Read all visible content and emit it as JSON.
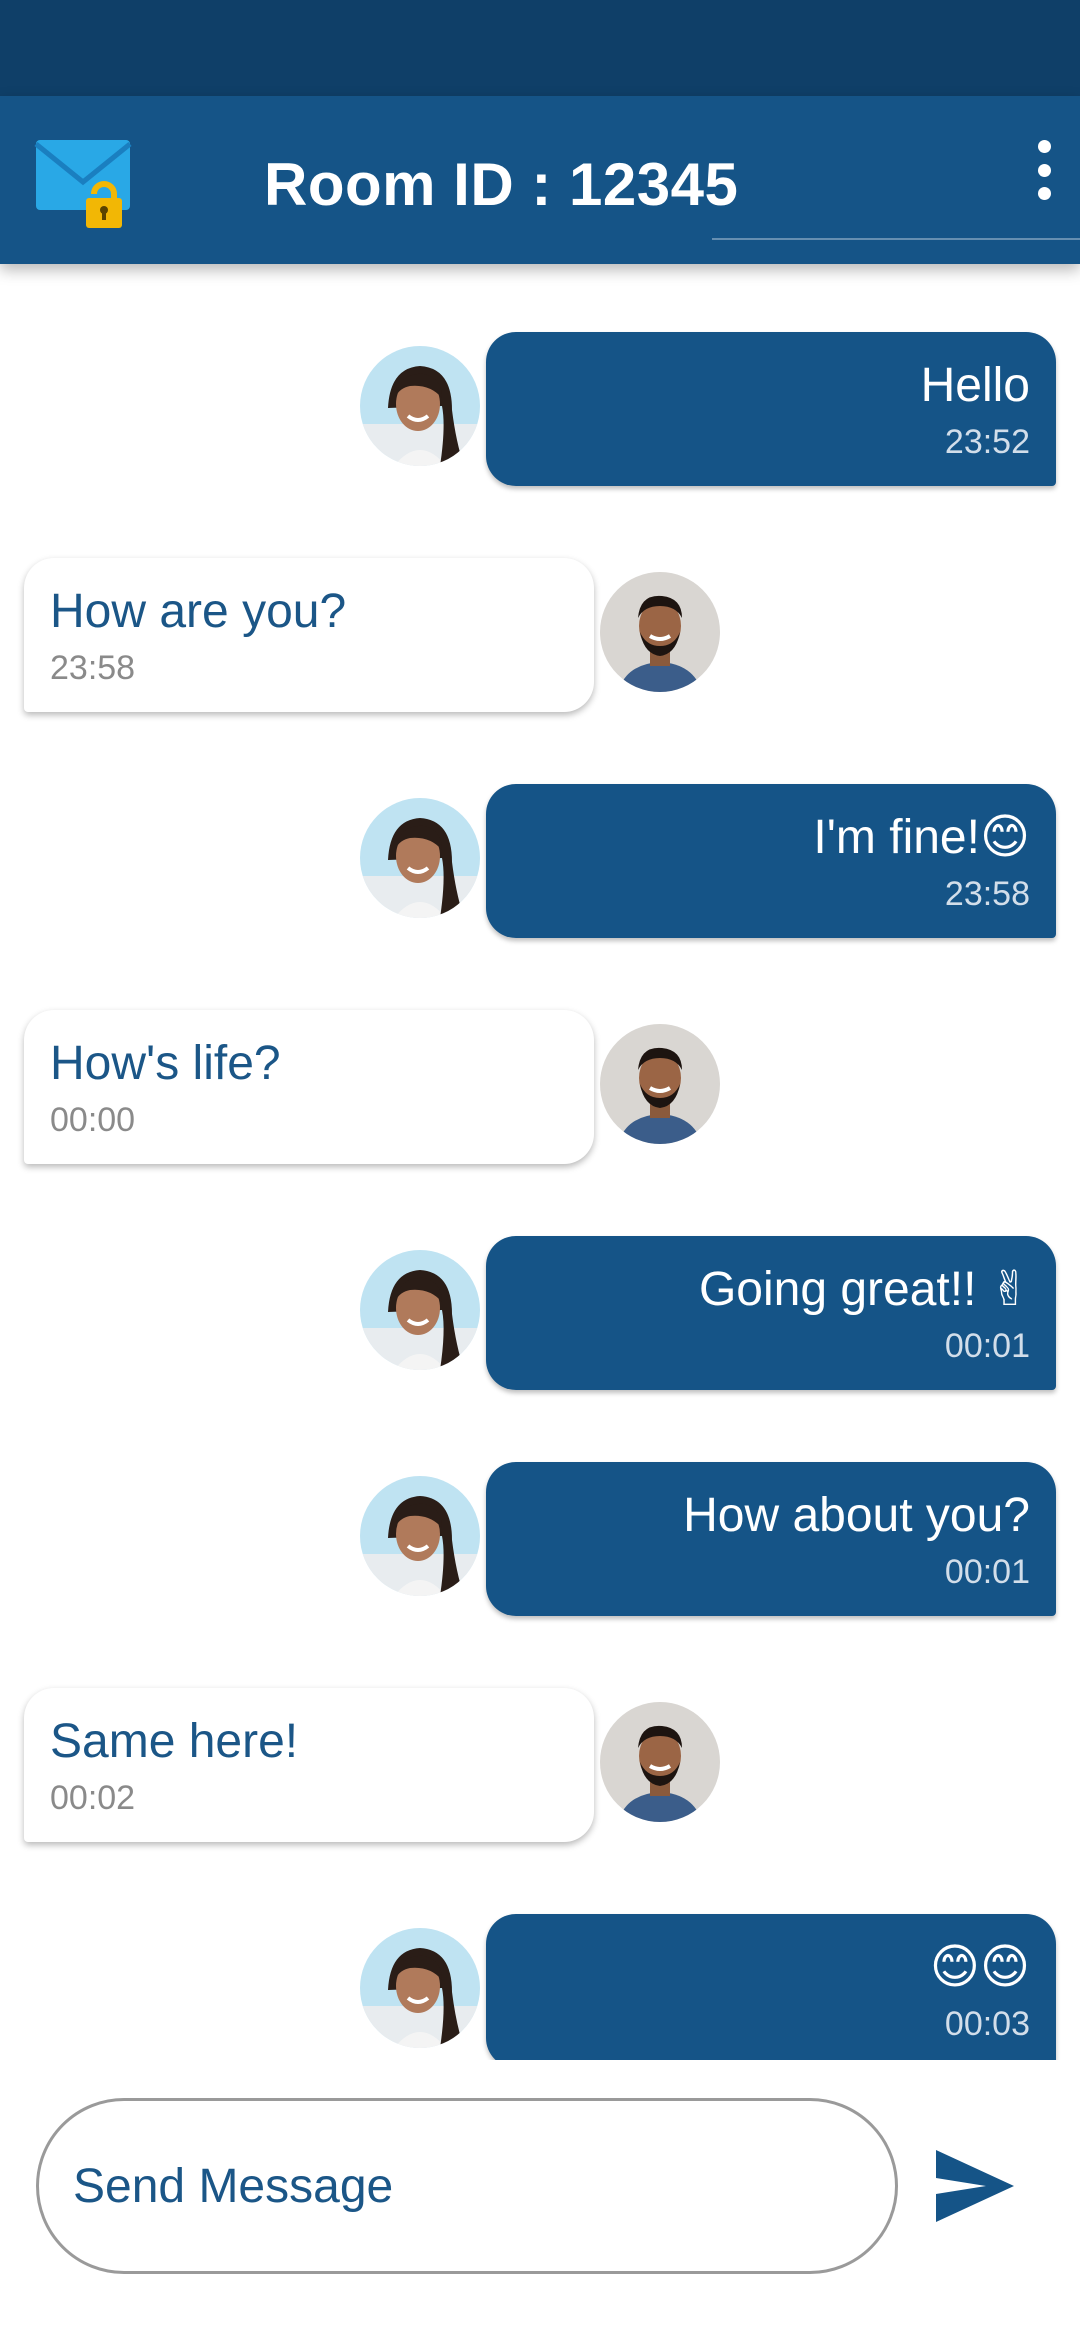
{
  "app_bar": {
    "title": "Room ID : 12345",
    "logo_icon": "mail-lock-icon",
    "menu_icon": "more-vert-icon"
  },
  "colors": {
    "primary": "#155487",
    "status_bar": "#0f3f68",
    "sent_bubble": "#155487",
    "received_bubble": "#ffffff",
    "received_text": "#1b5687"
  },
  "messages": [
    {
      "direction": "sent",
      "text": "Hello",
      "time": "23:52"
    },
    {
      "direction": "received",
      "text": "How are you?",
      "time": "23:58"
    },
    {
      "direction": "sent",
      "text": "I'm fine!😊",
      "time": "23:58"
    },
    {
      "direction": "received",
      "text": "How's life?",
      "time": "00:00"
    },
    {
      "direction": "sent",
      "text": "Going great!! ✌",
      "time": "00:01"
    },
    {
      "direction": "sent",
      "text": "How about you?",
      "time": "00:01"
    },
    {
      "direction": "received",
      "text": "Same here!",
      "time": "00:02"
    },
    {
      "direction": "sent",
      "text": "😊😊",
      "time": "00:03"
    }
  ],
  "composer": {
    "placeholder": "Send Message",
    "send_icon": "send-icon"
  }
}
